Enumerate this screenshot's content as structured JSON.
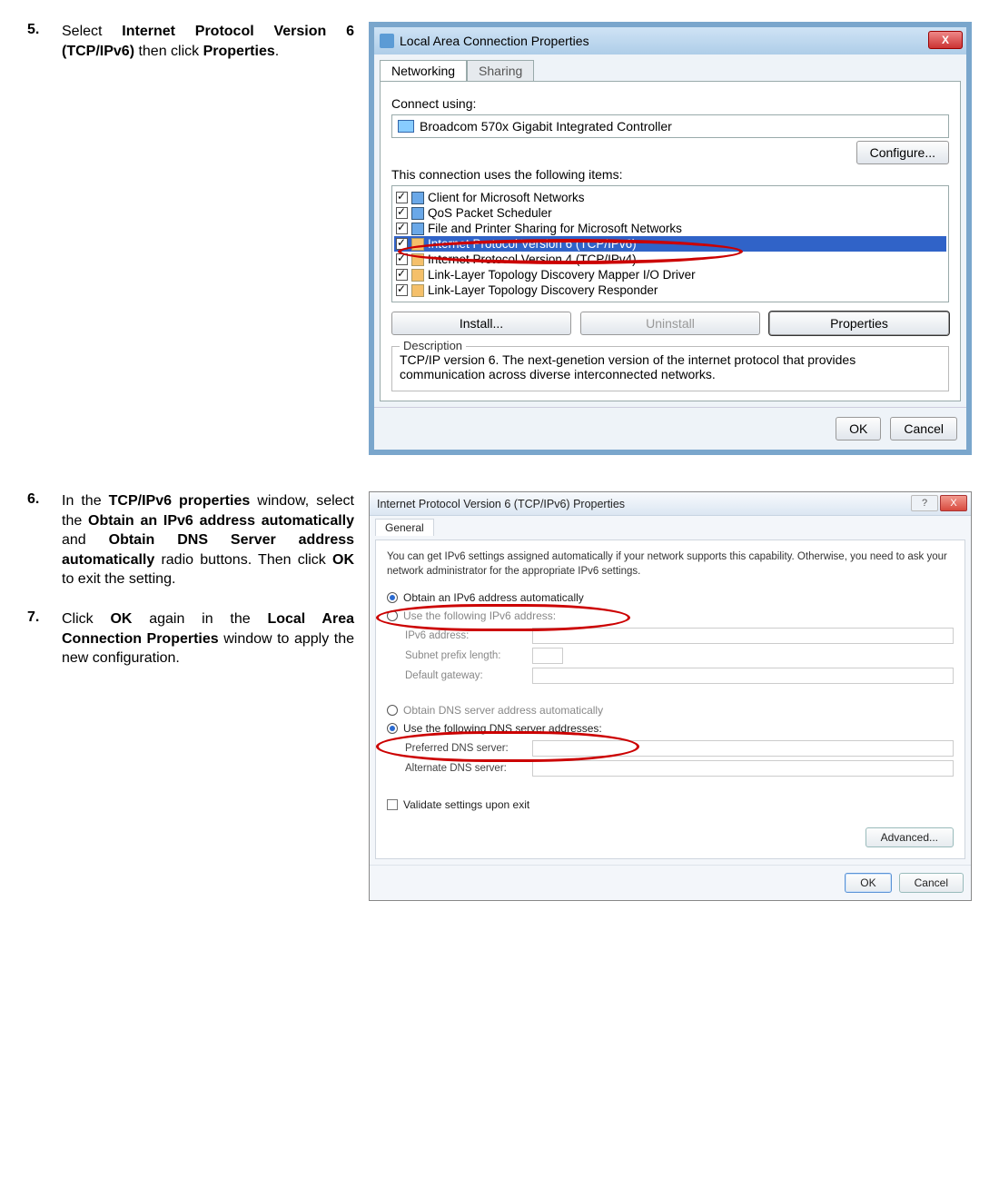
{
  "steps": {
    "s5_num": "5.",
    "s5_a": "Select ",
    "s5_b": "Internet Protocol Version 6 (TCP/IPv6)",
    "s5_c": " then click ",
    "s5_d": "Properties",
    "s5_e": ".",
    "s6_num": "6.",
    "s6_a": "In the ",
    "s6_b": "TCP/IPv6 properties",
    "s6_c": " window, select the ",
    "s6_d": "Obtain an IPv6 address automatically",
    "s6_e": " and ",
    "s6_f": "Obtain DNS Server address automatically",
    "s6_g": " radio buttons. Then click ",
    "s6_h": "OK",
    "s6_i": " to exit the setting.",
    "s7_num": "7.",
    "s7_a": "Click ",
    "s7_b": "OK",
    "s7_c": " again in the ",
    "s7_d": "Local Area Connection Properties",
    "s7_e": " window to apply the new configuration."
  },
  "dlg1": {
    "title": "Local Area Connection Properties",
    "tab_net": "Networking",
    "tab_share": "Sharing",
    "connect_label": "Connect using:",
    "adapter": "Broadcom 570x Gigabit Integrated Controller",
    "configure": "Configure...",
    "items_label": "This connection uses the following items:",
    "items": {
      "i0": "Client for Microsoft Networks",
      "i1": "QoS Packet Scheduler",
      "i2": "File and Printer Sharing for Microsoft Networks",
      "i3": "Internet Protocol Version 6  (TCP/IPv6)",
      "i4": "Internet Protocol Version 4  (TCP/IPv4)",
      "i5": "Link-Layer Topology Discovery Mapper I/O Driver",
      "i6": "Link-Layer Topology Discovery Responder"
    },
    "install": "Install...",
    "uninstall": "Uninstall",
    "properties": "Properties",
    "desc_label": "Description",
    "desc_text": "TCP/IP version 6. The next-genetion version of the internet protocol that provides communication across diverse interconnected networks.",
    "ok": "OK",
    "cancel": "Cancel",
    "close_x": "X"
  },
  "dlg2": {
    "title": "Internet Protocol Version 6 (TCP/IPv6) Properties",
    "tab": "General",
    "info": "You can get IPv6 settings assigned automatically if your network supports this capability. Otherwise, you need to ask your network administrator for the appropriate IPv6 settings.",
    "r_auto_ip": "Obtain an IPv6 address automatically",
    "r_use_ip": "Use the following IPv6 address:",
    "f_ip": "IPv6 address:",
    "f_prefix": "Subnet prefix length:",
    "f_gw": "Default gateway:",
    "r_auto_dns": "Obtain DNS server address automatically",
    "r_use_dns": "Use the following DNS server addresses:",
    "f_pdns": "Preferred DNS server:",
    "f_adns": "Alternate DNS server:",
    "validate": "Validate settings upon exit",
    "advanced": "Advanced...",
    "ok": "OK",
    "cancel": "Cancel",
    "help": "?",
    "close_x": "X"
  }
}
